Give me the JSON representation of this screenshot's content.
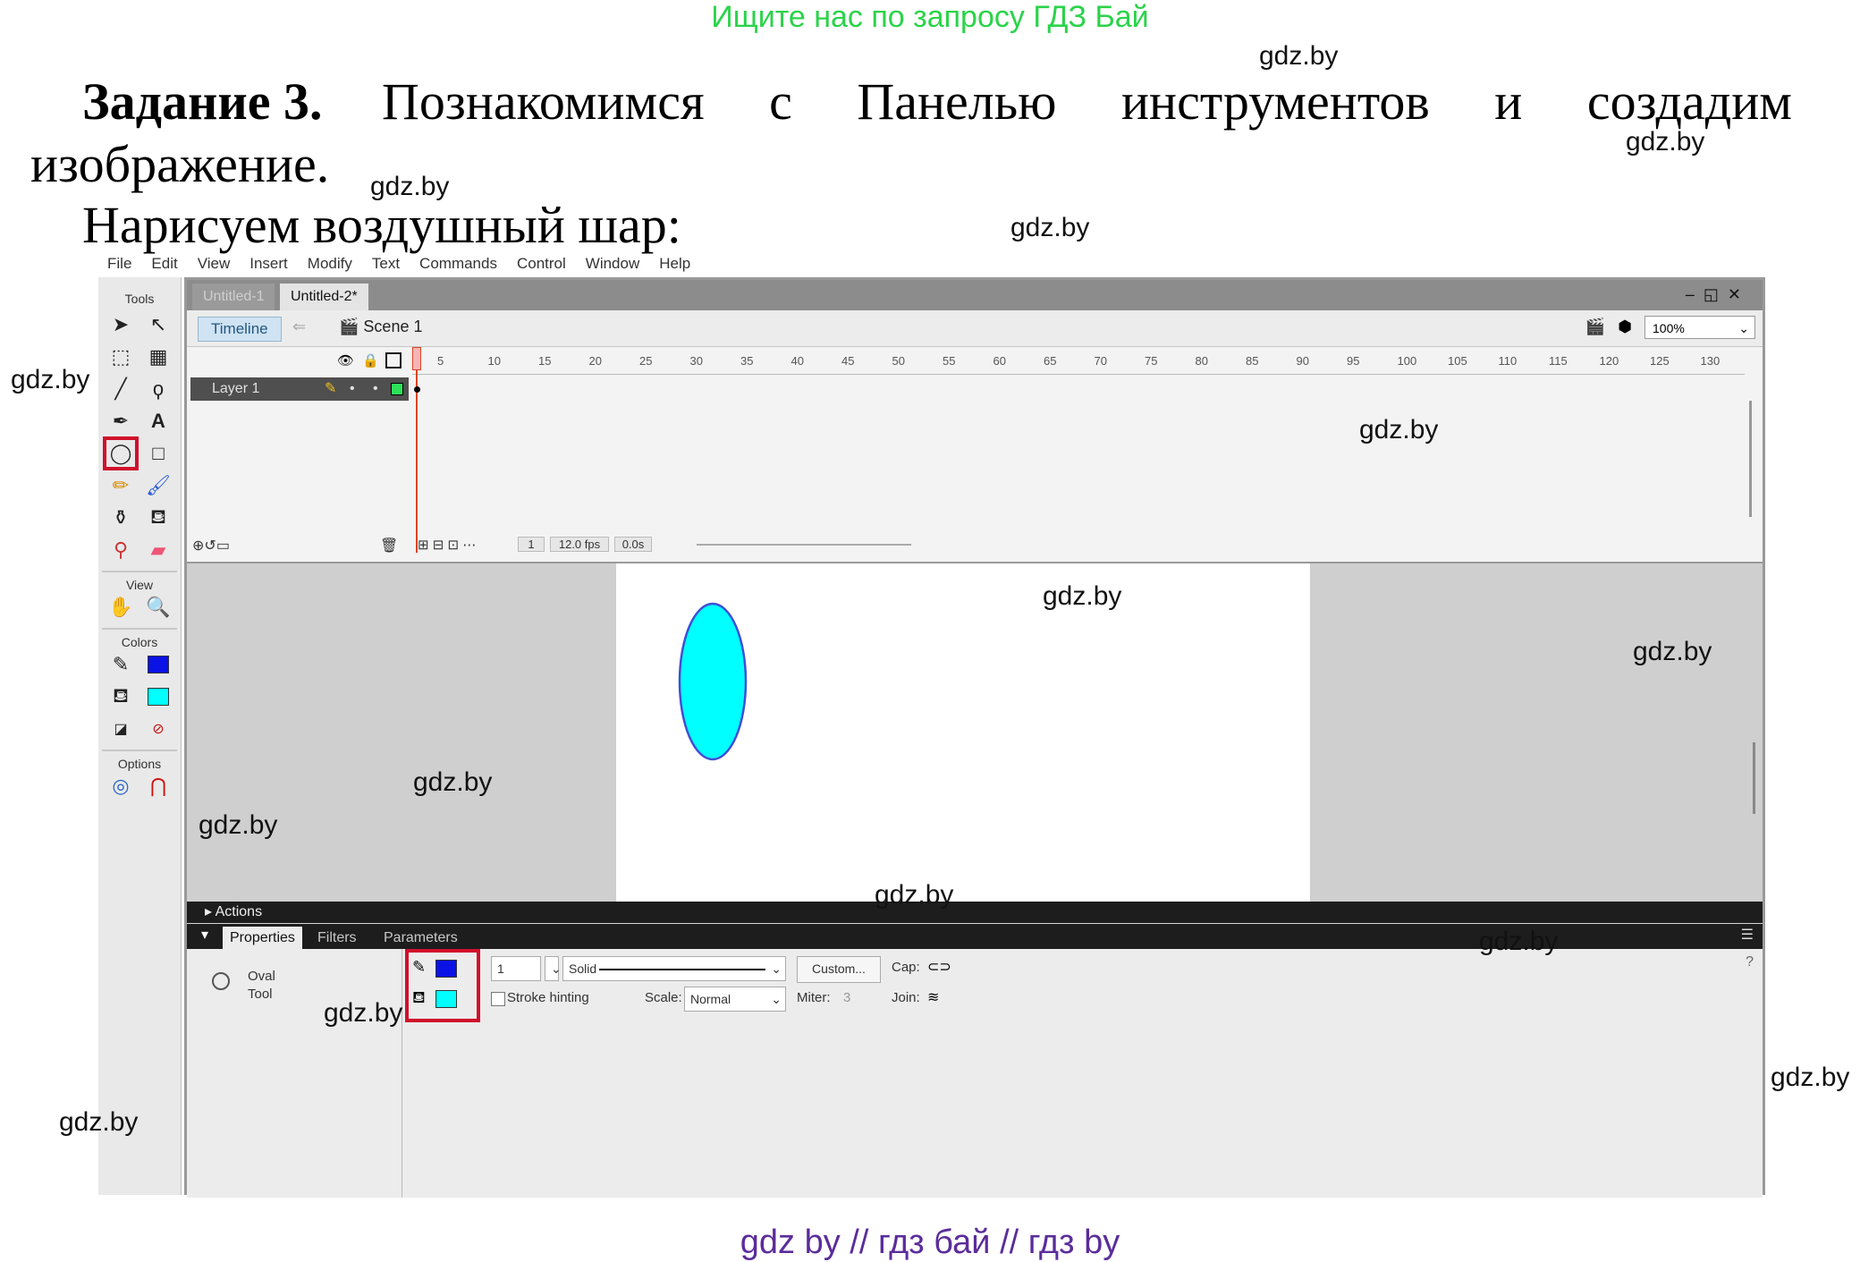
{
  "banner": "Ищите нас по запросу ГДЗ Бай",
  "heading": {
    "task_bold": "Задание 3.",
    "task_rest": "Познакомимся с Панелью инструментов и создадим",
    "task_line2": "изображение.",
    "subtitle": "Нарисуем воздушный шар:"
  },
  "watermark": "gdz.by",
  "footer": "gdz by  //  гдз бай  //  гдз by",
  "app": {
    "menu": [
      "File",
      "Edit",
      "View",
      "Insert",
      "Modify",
      "Text",
      "Commands",
      "Control",
      "Window",
      "Help"
    ],
    "tools_title": "Tools",
    "view_title": "View",
    "colors_title": "Colors",
    "options_title": "Options",
    "tabs": [
      "Untitled-1",
      "Untitled-2*"
    ],
    "timeline_button": "Timeline",
    "scene": "Scene 1",
    "zoom": "100%",
    "layer": "Layer 1",
    "ruler": [
      "5",
      "10",
      "15",
      "20",
      "25",
      "30",
      "35",
      "40",
      "45",
      "50",
      "55",
      "60",
      "65",
      "70",
      "75",
      "80",
      "85",
      "90",
      "95",
      "100",
      "105",
      "110",
      "115",
      "120",
      "125",
      "130"
    ],
    "status": {
      "frame": "1",
      "fps": "12.0 fps",
      "time": "0.0s"
    },
    "actions_label": "Actions",
    "prop_tabs": [
      "Properties",
      "Filters",
      "Parameters"
    ],
    "tool_name_1": "Oval",
    "tool_name_2": "Tool",
    "stroke_width": "1",
    "stroke_style": "Solid",
    "custom_button": "Custom...",
    "cap_label": "Cap:",
    "stroke_hinting": "Stroke hinting",
    "scale_label": "Scale:",
    "scale_value": "Normal",
    "miter_label": "Miter:",
    "miter_value": "3",
    "join_label": "Join:",
    "stroke_color": "#0a12e6",
    "fill_color": "#00ffff"
  }
}
